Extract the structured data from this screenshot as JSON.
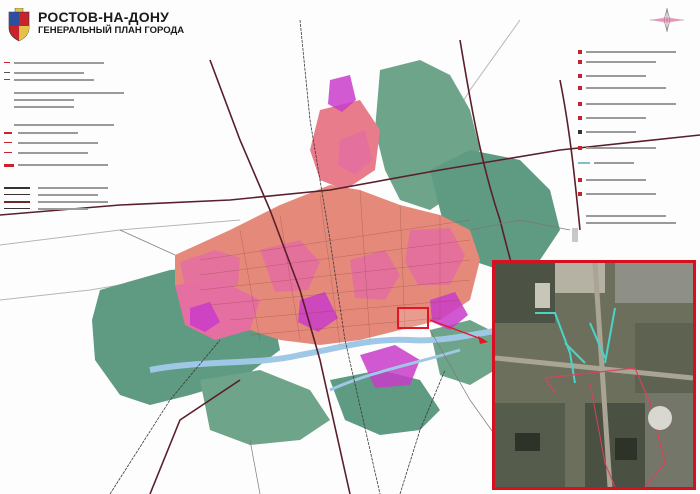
{
  "title": {
    "city": "РОСТОВ-НА-ДОНУ",
    "plan": "ГЕНЕРАЛЬНЫЙ ПЛАН ГОРОДА"
  },
  "colors": {
    "urban_pink": "#e46fa0",
    "residential_salmon": "#e58a7a",
    "green_zone": "#5f9a82",
    "magenta": "#d13fd0",
    "river": "#9fc8e6",
    "frame_red": "#d7101f"
  }
}
